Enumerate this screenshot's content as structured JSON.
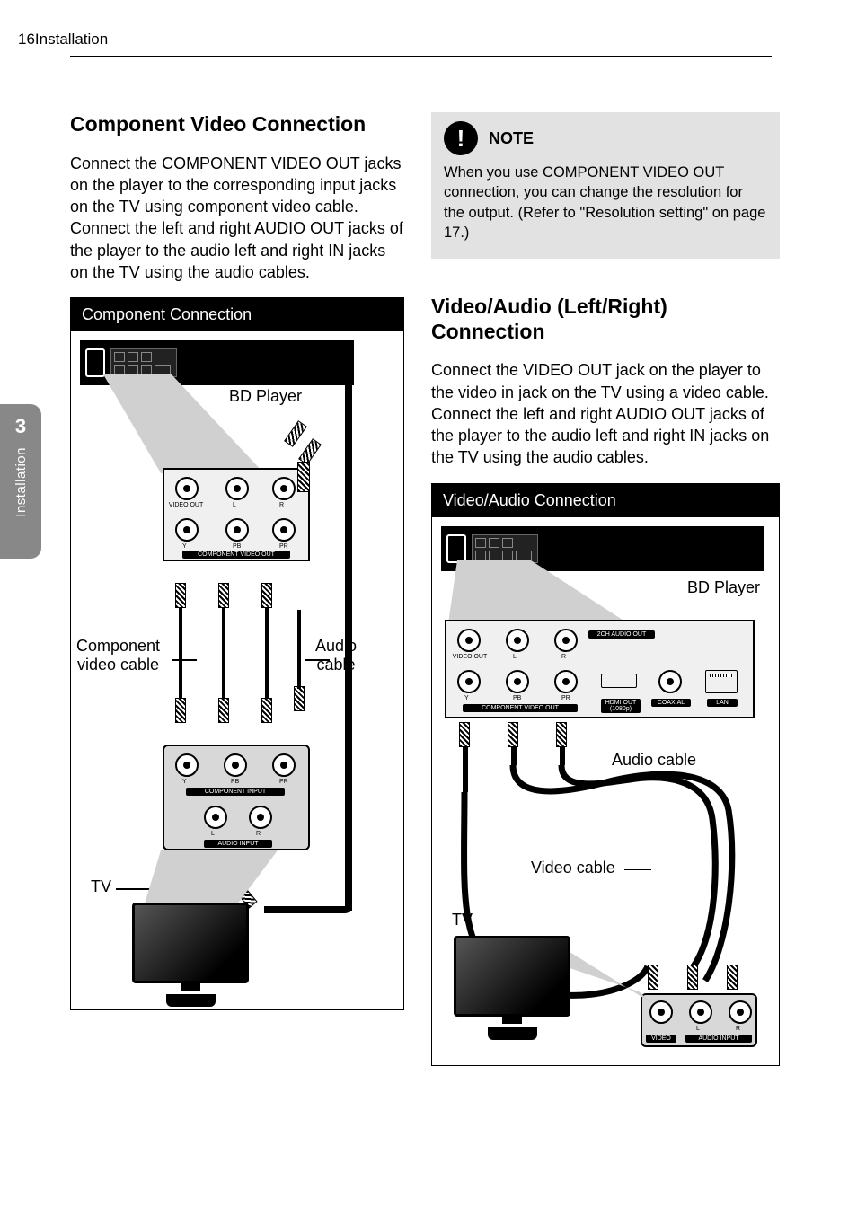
{
  "header": {
    "page_number": "16",
    "section": "Installation"
  },
  "side_tab": {
    "chapter_number": "3",
    "label": "Installation"
  },
  "left": {
    "title": "Component Video Connection",
    "body": "Connect the COMPONENT VIDEO OUT jacks on the player to the corresponding input jacks on the TV using component video cable. Connect the left and right AUDIO OUT jacks of the player to the audio left and right IN jacks on the TV using the audio cables.",
    "diagram": {
      "header": "Component Connection",
      "labels": {
        "bd_player": "BD Player",
        "component_video_cable": "Component\nvideo cable",
        "audio_cable": "Audio\ncable",
        "tv": "TV"
      },
      "panel_labels": {
        "video_out": "VIDEO OUT",
        "l": "L",
        "r": "R",
        "y": "Y",
        "pb": "PB",
        "pr": "PR",
        "component_video_out": "COMPONENT VIDEO OUT",
        "component_input": "COMPONENT INPUT",
        "audio_input": "AUDIO INPUT"
      }
    }
  },
  "right": {
    "note": {
      "title": "NOTE",
      "text": "When you use COMPONENT VIDEO OUT connection, you can change the resolution for the output. (Refer to \"Resolution setting\" on page 17.)"
    },
    "title": "Video/Audio (Left/Right) Connection",
    "body": "Connect the VIDEO OUT jack on the player to the video in jack on the TV using a video cable. Connect the left and right AUDIO OUT jacks of the player to the audio left and right IN jacks on the TV using the audio cables.",
    "diagram": {
      "header": "Video/Audio Connection",
      "labels": {
        "bd_player": "BD Player",
        "audio_cable": "Audio cable",
        "video_cable": "Video cable",
        "tv": "TV"
      },
      "panel_labels": {
        "video_out": "VIDEO OUT",
        "l": "L",
        "r": "R",
        "two_ch_audio_out": "2CH AUDIO OUT",
        "y": "Y",
        "pb": "PB",
        "pr": "PR",
        "component_video_out": "COMPONENT VIDEO OUT",
        "hdmi_out": "HDMI OUT\n(1080p)",
        "coaxial": "COAXIAL",
        "lan": "LAN",
        "video": "VIDEO",
        "audio_input": "AUDIO INPUT"
      }
    }
  }
}
